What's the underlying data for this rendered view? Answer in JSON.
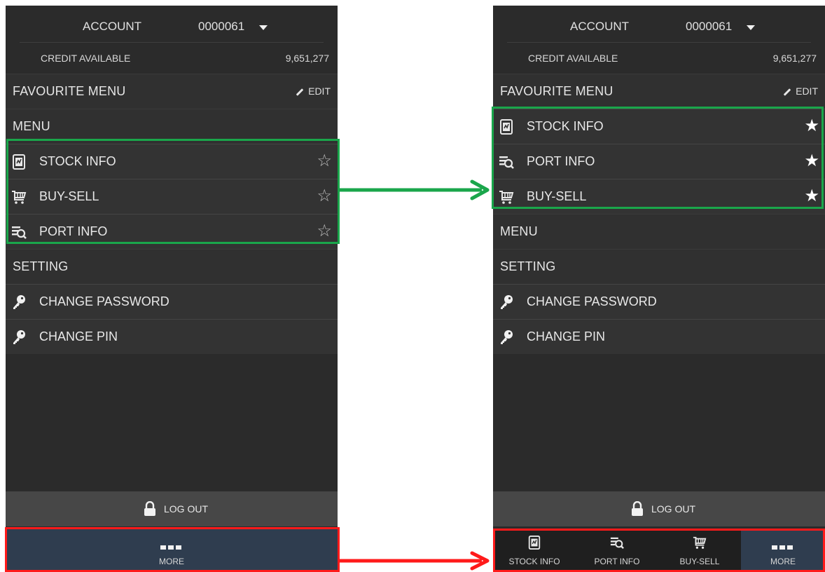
{
  "left": {
    "account": {
      "label": "ACCOUNT",
      "value": "0000061"
    },
    "credit": {
      "label": "CREDIT AVAILABLE",
      "value": "9,651,277"
    },
    "favourite_title": "FAVOURITE MENU",
    "edit_label": "EDIT",
    "menu_title": "MENU",
    "menu_items": [
      {
        "label": "STOCK INFO",
        "icon": "stock-info-icon",
        "star": "empty"
      },
      {
        "label": "BUY-SELL",
        "icon": "cart-icon",
        "star": "empty"
      },
      {
        "label": "PORT INFO",
        "icon": "port-info-icon",
        "star": "empty"
      }
    ],
    "setting_title": "SETTING",
    "setting_items": [
      {
        "label": "CHANGE PASSWORD",
        "icon": "key-icon"
      },
      {
        "label": "CHANGE PIN",
        "icon": "key-icon"
      }
    ],
    "logout_label": "LOG OUT",
    "bottom_tabs": [
      {
        "label": "MORE",
        "icon": "more-icon",
        "active": true
      }
    ]
  },
  "right": {
    "account": {
      "label": "ACCOUNT",
      "value": "0000061"
    },
    "credit": {
      "label": "CREDIT AVAILABLE",
      "value": "9,651,277"
    },
    "favourite_title": "FAVOURITE MENU",
    "edit_label": "EDIT",
    "favourite_items": [
      {
        "label": "STOCK INFO",
        "icon": "stock-info-icon",
        "star": "full"
      },
      {
        "label": "PORT INFO",
        "icon": "port-info-icon",
        "star": "full"
      },
      {
        "label": "BUY-SELL",
        "icon": "cart-icon",
        "star": "full"
      }
    ],
    "menu_title": "MENU",
    "setting_title": "SETTING",
    "setting_items": [
      {
        "label": "CHANGE PASSWORD",
        "icon": "key-icon"
      },
      {
        "label": "CHANGE PIN",
        "icon": "key-icon"
      }
    ],
    "logout_label": "LOG OUT",
    "bottom_tabs": [
      {
        "label": "STOCK INFO",
        "icon": "stock-info-icon",
        "active": false
      },
      {
        "label": "PORT INFO",
        "icon": "port-info-icon",
        "active": false
      },
      {
        "label": "BUY-SELL",
        "icon": "cart-icon",
        "active": false
      },
      {
        "label": "MORE",
        "icon": "more-icon",
        "active": true
      }
    ]
  },
  "colors": {
    "highlight_green": "#1aa64b",
    "highlight_red": "#ff1a1a",
    "panel_bg": "#2b2b2b",
    "tabbar_active": "#2f3d4f"
  }
}
